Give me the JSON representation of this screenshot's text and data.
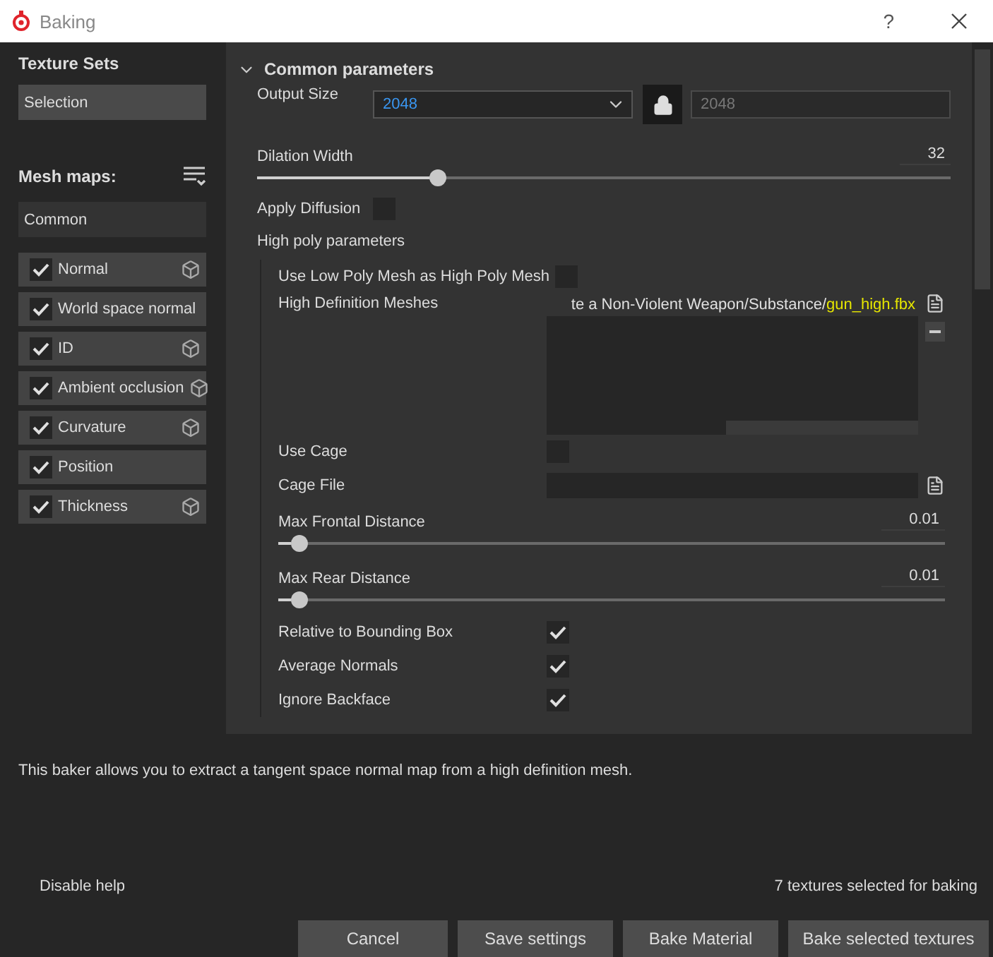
{
  "window": {
    "title": "Baking",
    "help": "?"
  },
  "texture_sets": {
    "heading": "Texture Sets",
    "selection": "Selection"
  },
  "mesh_maps": {
    "heading": "Mesh maps:",
    "group": "Common",
    "items": [
      {
        "label": "Normal",
        "checked": true,
        "mesh_icon": true
      },
      {
        "label": "World space normal",
        "checked": true,
        "mesh_icon": false
      },
      {
        "label": "ID",
        "checked": true,
        "mesh_icon": true
      },
      {
        "label": "Ambient occlusion",
        "checked": true,
        "mesh_icon": true
      },
      {
        "label": "Curvature",
        "checked": true,
        "mesh_icon": true
      },
      {
        "label": "Position",
        "checked": true,
        "mesh_icon": false
      },
      {
        "label": "Thickness",
        "checked": true,
        "mesh_icon": true
      }
    ]
  },
  "parameters": {
    "section": "Common parameters",
    "expanded": true,
    "output_size": {
      "label": "Output Size",
      "value": "2048",
      "linked_value": "2048",
      "locked": true
    },
    "dilation": {
      "label": "Dilation Width",
      "reading": "32",
      "level": 0.255
    },
    "apply_diffusion": {
      "label": "Apply Diffusion",
      "checked": false
    },
    "high_poly": {
      "label": "High poly parameters",
      "rows": [
        {
          "kind": "checkbox",
          "label": "Use Low Poly Mesh as High Poly Mesh",
          "checked": false
        },
        {
          "kind": "file_list",
          "label": "High Definition Meshes",
          "path": "te a Non-Violent Weapon/Substance/",
          "file": "gun_high.fbx"
        },
        {
          "kind": "checkbox",
          "label": "Use Cage",
          "checked": false
        },
        {
          "kind": "file",
          "label": "Cage File"
        },
        {
          "kind": "slider",
          "label": "Max Frontal Distance",
          "reading": "0.01",
          "level": 0.02
        },
        {
          "kind": "slider",
          "label": "Max Rear Distance",
          "reading": "0.01",
          "level": 0.02
        },
        {
          "kind": "checkbox",
          "label": "Relative to Bounding Box",
          "checked": true
        },
        {
          "kind": "checkbox",
          "label": "Average Normals",
          "checked": true
        },
        {
          "kind": "checkbox",
          "label": "Ignore Backface",
          "checked": true
        }
      ]
    }
  },
  "help_text": "This baker allows you to extract a tangent space normal map from a high definition mesh.",
  "footer": {
    "disable_help": "Disable help",
    "status": "7 textures selected for baking"
  },
  "buttons": [
    "Cancel",
    "Save settings",
    "Bake Material",
    "Bake selected textures"
  ]
}
